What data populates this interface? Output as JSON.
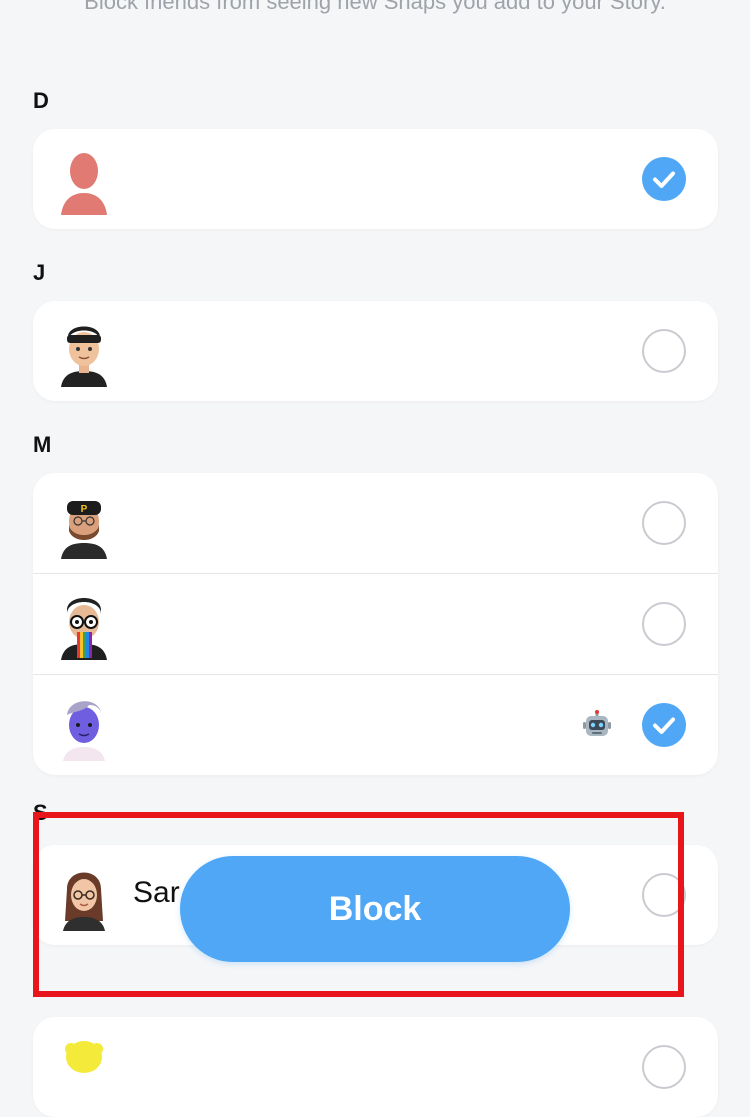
{
  "header": {
    "subtitle": "Block friends from seeing new Snaps you add to your Story."
  },
  "sections": {
    "d": {
      "letter": "D"
    },
    "j": {
      "letter": "J"
    },
    "m": {
      "letter": "M"
    },
    "s": {
      "letter": "S"
    }
  },
  "rows": [
    {
      "section": "D",
      "avatar": "default-silhouette-avatar",
      "name": "",
      "selected": true
    },
    {
      "section": "J",
      "avatar": "bitmoji-cap-avatar",
      "name": "",
      "selected": false
    },
    {
      "section": "M",
      "avatar": "bitmoji-bearded-cap-avatar",
      "name": "",
      "selected": false
    },
    {
      "section": "M",
      "avatar": "bitmoji-glasses-rainbow-avatar",
      "name": "",
      "selected": false
    },
    {
      "section": "M",
      "avatar": "bitmoji-purple-avatar",
      "name": "",
      "badge": "robot-emoji-icon",
      "selected": true
    },
    {
      "section": "S",
      "avatar": "bitmoji-woman-glasses-avatar",
      "name": "Sar",
      "selected": false
    },
    {
      "section": "S",
      "avatar": "bitmoji-yellow-avatar",
      "name": "",
      "selected": false
    }
  ],
  "action": {
    "block_label": "Block"
  },
  "colors": {
    "accent": "#50a7f5",
    "highlight": "#e8151a",
    "background": "#f5f6f8"
  }
}
